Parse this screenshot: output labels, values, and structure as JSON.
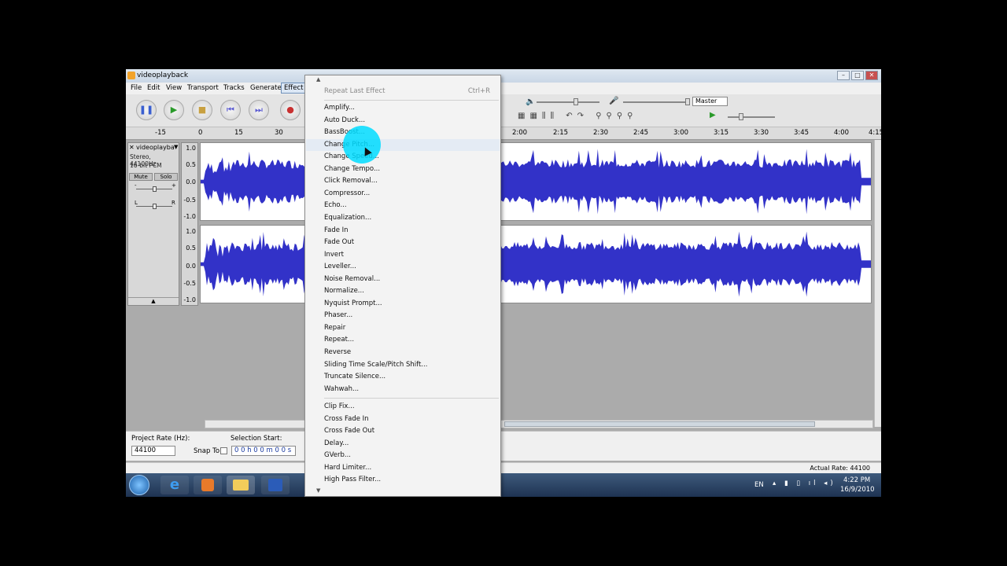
{
  "window": {
    "title": "videoplayback"
  },
  "menubar": [
    "File",
    "Edit",
    "View",
    "Transport",
    "Tracks",
    "Generate",
    "Effect"
  ],
  "ruler": {
    "left_ticks": [
      "-15",
      "0",
      "15",
      "30"
    ],
    "right_ticks": [
      "2:00",
      "2:15",
      "2:30",
      "2:45",
      "3:00",
      "3:15",
      "3:30",
      "3:45",
      "4:00",
      "4:15"
    ]
  },
  "track": {
    "name": "videoplayba",
    "info_line1": "Stereo, 44100Hz",
    "info_line2": "16-bit PCM",
    "mute_label": "Mute",
    "solo_label": "Solo",
    "gain_minus": "-",
    "gain_plus": "+",
    "pan_left": "L",
    "pan_right": "R",
    "scale_labels": [
      "1.0",
      "0.5",
      "0.0",
      "-0.5",
      "-1.0"
    ],
    "collapse_glyph": "▲"
  },
  "meter": {
    "device_label": "Master"
  },
  "selection_bar": {
    "project_rate_label": "Project Rate (Hz):",
    "project_rate_value": "44100",
    "snap_to_label": "Snap To",
    "selection_start_label": "Selection Start:",
    "selection_start_value": "0 0 h 0 0 m 0 0 s"
  },
  "status": {
    "actual_rate": "Actual Rate: 44100"
  },
  "taskbar": {
    "lang": "EN",
    "time": "4:22 PM",
    "date": "16/9/2010"
  },
  "effect_menu": {
    "repeat_last": "Repeat Last Effect",
    "repeat_shortcut": "Ctrl+R",
    "items": [
      "Amplify...",
      "Auto Duck...",
      "BassBoost...",
      "Change Pitch...",
      "Change Speed...",
      "Change Tempo...",
      "Click Removal...",
      "Compressor...",
      "Echo...",
      "Equalization...",
      "Fade In",
      "Fade Out",
      "Invert",
      "Leveller...",
      "Noise Removal...",
      "Normalize...",
      "Nyquist Prompt...",
      "Phaser...",
      "Repair",
      "Repeat...",
      "Reverse",
      "Sliding Time Scale/Pitch Shift...",
      "Truncate Silence...",
      "Wahwah..."
    ],
    "items2": [
      "Clip Fix...",
      "Cross Fade In",
      "Cross Fade Out",
      "Delay...",
      "GVerb...",
      "Hard Limiter...",
      "High Pass Filter..."
    ],
    "highlighted": "Change Pitch..."
  },
  "colors": {
    "waveform": "#3232c8",
    "highlight": "#00dcff"
  }
}
